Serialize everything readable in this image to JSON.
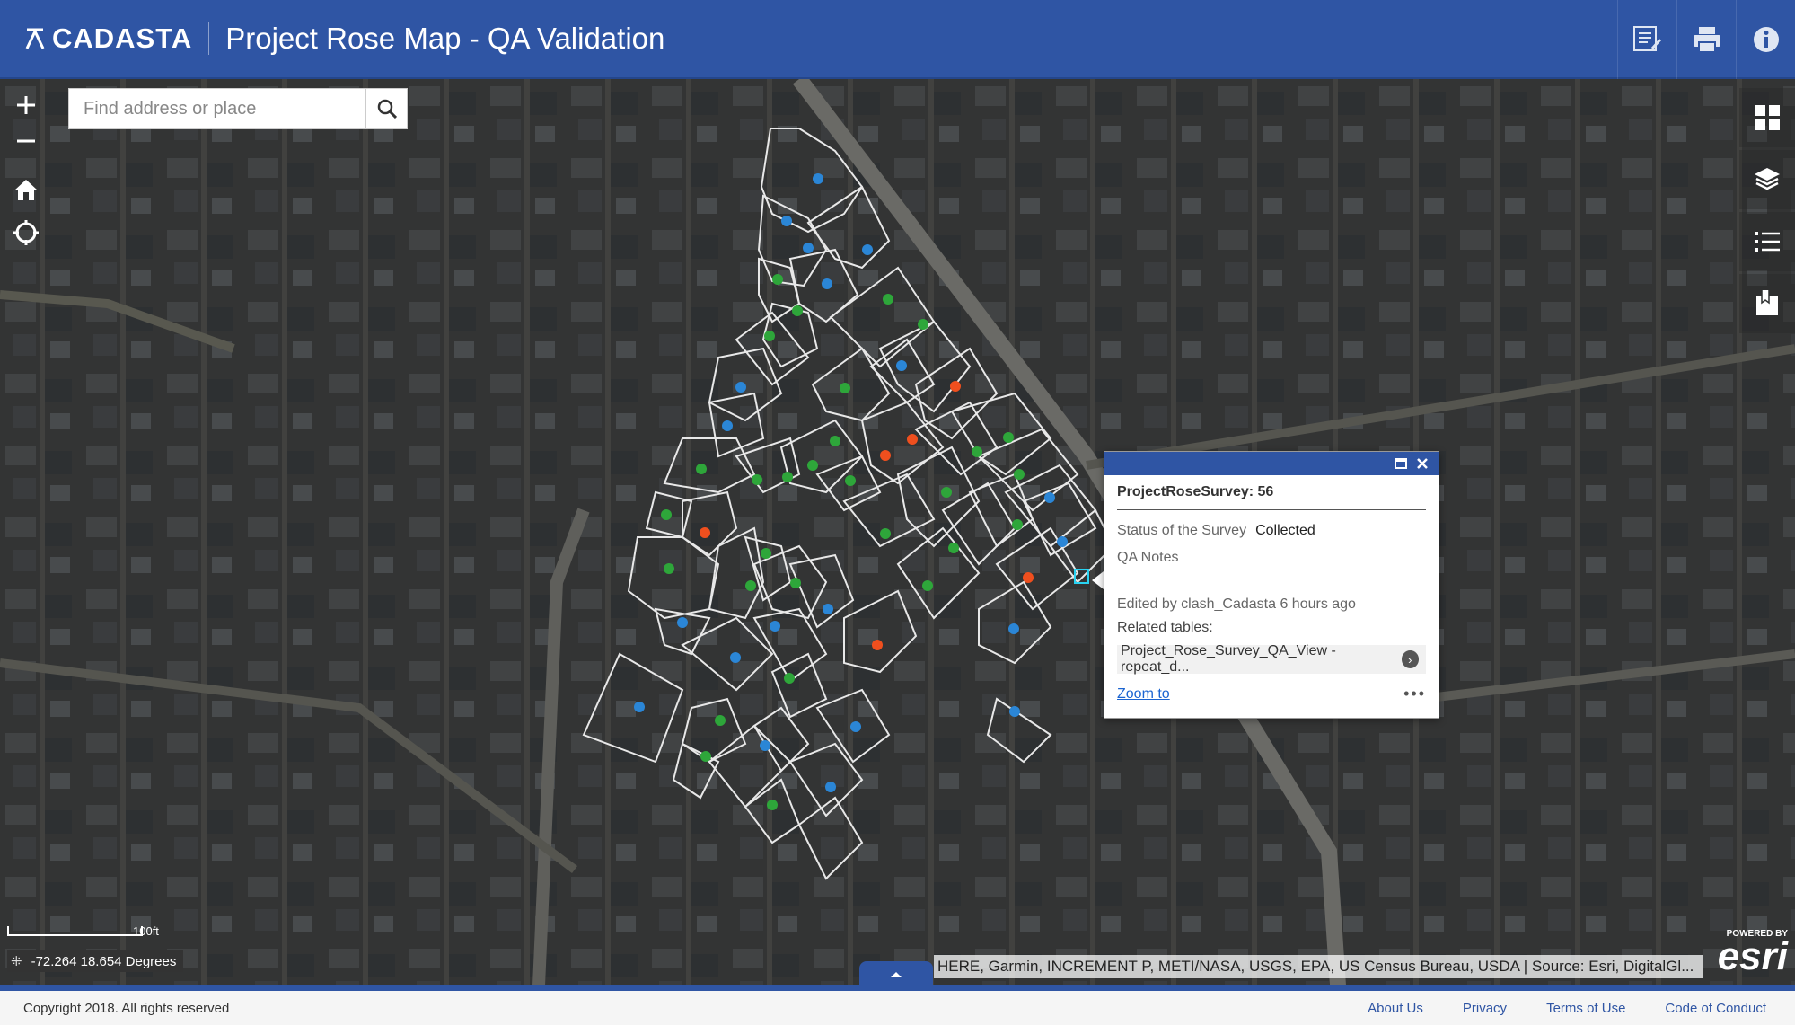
{
  "header": {
    "logo_text": "CADASTA",
    "title": "Project Rose Map - QA Validation",
    "buttons": [
      "edit-list-icon",
      "print-icon",
      "info-icon"
    ]
  },
  "search": {
    "placeholder": "Find address or place"
  },
  "map_controls": [
    "zoom-in",
    "zoom-out",
    "home",
    "locate"
  ],
  "right_tools": [
    "basemap-gallery",
    "layers",
    "legend",
    "bookmark"
  ],
  "popup": {
    "title": "ProjectRoseSurvey: 56",
    "fields": [
      {
        "label": "Status of the Survey",
        "value": "Collected"
      },
      {
        "label": "QA Notes",
        "value": ""
      }
    ],
    "edited": "Edited by clash_Cadasta 6 hours ago",
    "related_label": "Related tables:",
    "related_item": "Project_Rose_Survey_QA_View - repeat_d...",
    "zoom_to": "Zoom to",
    "more": "•••"
  },
  "scale_label": "100ft",
  "coordinates": "-72.264 18.654 Degrees",
  "attribution": "HERE, Garmin, INCREMENT P, METI/NASA, USGS, EPA, US Census Bureau, USDA | Source: Esri, DigitalGl...",
  "esri": {
    "powered_by": "POWERED BY",
    "logo": "esri"
  },
  "footer": {
    "copyright": "Copyright 2018. All rights reserved",
    "links": [
      "About Us",
      "Privacy",
      "Terms of Use",
      "Code of Conduct"
    ]
  },
  "colors": {
    "header": "#2f55a4",
    "point_blue": "#2b86d6",
    "point_green": "#2ea63a",
    "point_orange": "#ef4f1e",
    "parcel_outline": "#e8e8e8"
  }
}
